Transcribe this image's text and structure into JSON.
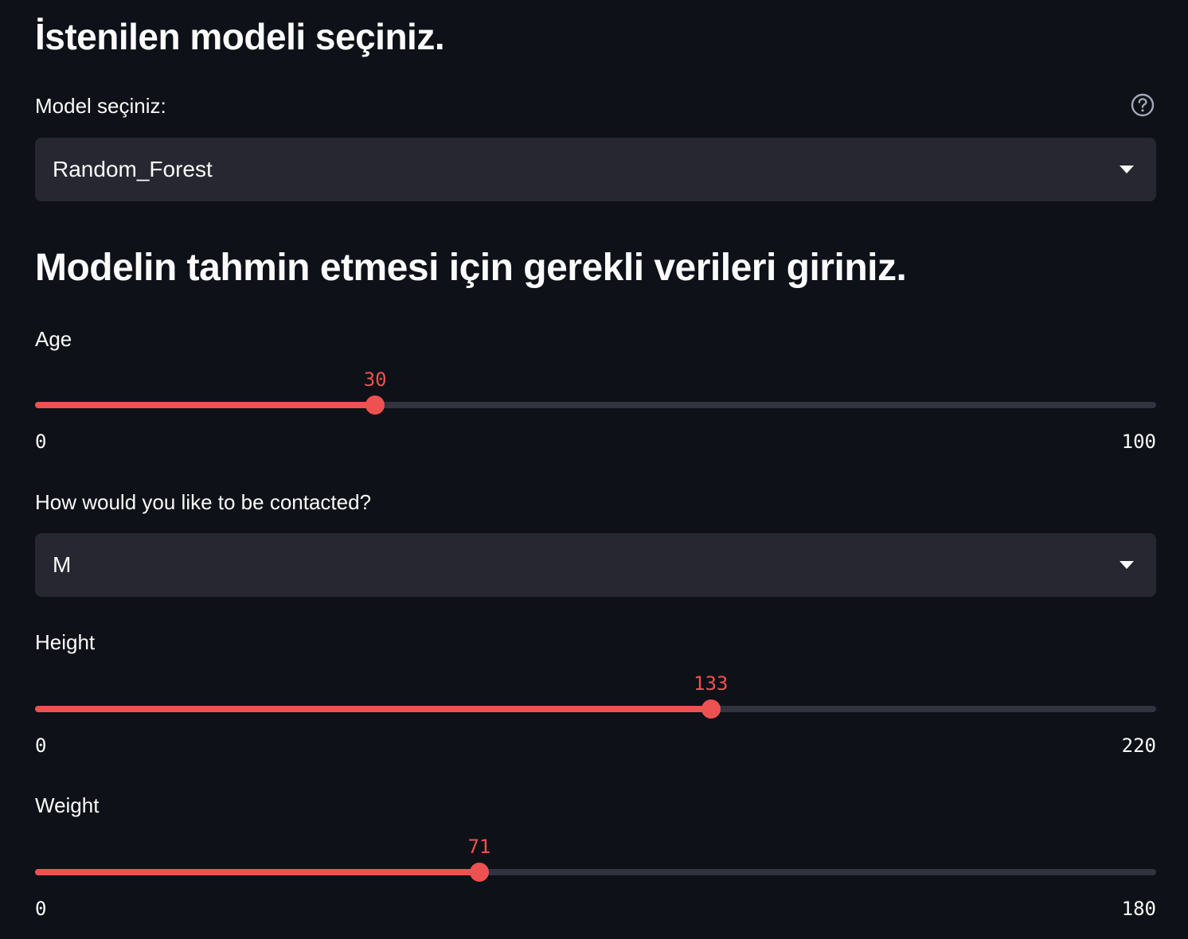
{
  "title": "İstenilen modeli seçiniz.",
  "model_select": {
    "label": "Model seçiniz:",
    "value": "Random_Forest",
    "help_icon": "question-circle-icon",
    "chevron_icon": "chevron-down-icon"
  },
  "subtitle": "Modelin tahmin etmesi için gerekli verileri giriniz.",
  "age": {
    "label": "Age",
    "value": "30",
    "min": "0",
    "max": "100"
  },
  "contact_select": {
    "label": "How would you like to be contacted?",
    "value": "M",
    "chevron_icon": "chevron-down-icon"
  },
  "height": {
    "label": "Height",
    "value": "133",
    "min": "0",
    "max": "220"
  },
  "weight": {
    "label": "Weight",
    "value": "71",
    "min": "0",
    "max": "180"
  },
  "colors": {
    "accent": "#ee5151",
    "background": "#0e1117",
    "input_bg": "#262730",
    "track": "#31333f",
    "text": "#fafafa"
  }
}
